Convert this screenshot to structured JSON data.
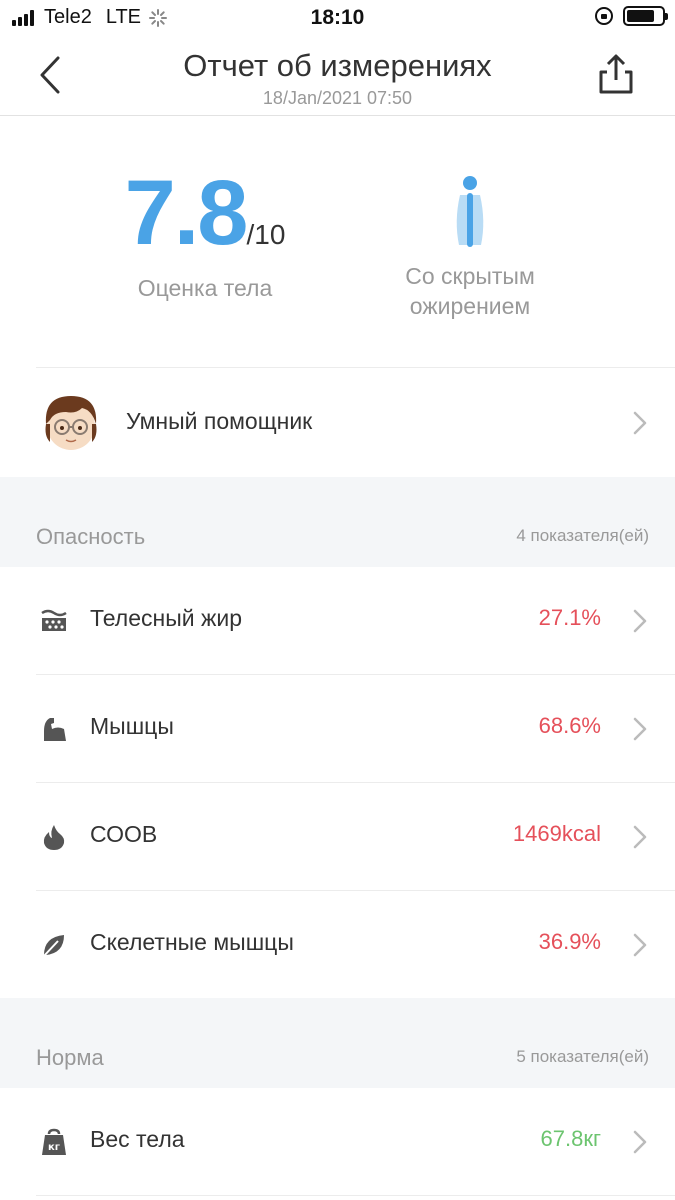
{
  "status_bar": {
    "carrier": "Tele2",
    "network": "LTE",
    "time": "18:10"
  },
  "header": {
    "title": "Отчет об измерениях",
    "subtitle": "18/Jan/2021 07:50"
  },
  "score": {
    "value": "7.8",
    "denominator": "/10",
    "label": "Оценка тела"
  },
  "body_type": {
    "line1": "Со скрытым",
    "line2": "ожирением"
  },
  "assistant": {
    "label": "Умный помощник"
  },
  "sections": {
    "danger": {
      "title": "Опасность",
      "count": "4 показателя(ей)",
      "color": "#e5505a",
      "items": [
        {
          "label": "Телесный жир",
          "value": "27.1%",
          "icon": "body-fat-icon"
        },
        {
          "label": "Мышцы",
          "value": "68.6%",
          "icon": "muscle-icon"
        },
        {
          "label": "СООВ",
          "value": "1469kcal",
          "icon": "flame-icon"
        },
        {
          "label": "Скелетные мышцы",
          "value": "36.9%",
          "icon": "leaf-icon"
        }
      ]
    },
    "normal": {
      "title": "Норма",
      "count": "5 показателя(ей)",
      "color": "#6cc46f",
      "items": [
        {
          "label": "Вес тела",
          "value": "67.8кг",
          "icon": "weight-kg-icon",
          "icon_text": "кг"
        }
      ]
    }
  },
  "colors": {
    "accent": "#4aa3e6",
    "danger": "#e5505a",
    "normal": "#6cc46f"
  }
}
